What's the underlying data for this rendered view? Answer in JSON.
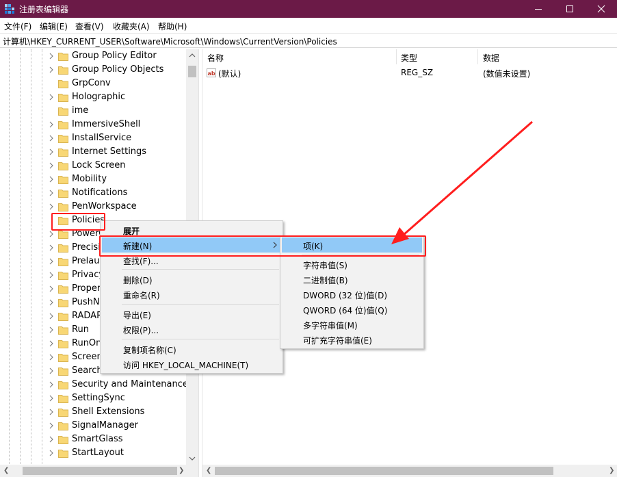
{
  "window": {
    "title": "注册表编辑器",
    "icon": "registry-editor-icon",
    "colors": {
      "titlebar": "#6b1a47",
      "highlight": "#91c9f7",
      "annotation": "#ff1e1e"
    }
  },
  "menubar": {
    "items": [
      "文件(F)",
      "编辑(E)",
      "查看(V)",
      "收藏夹(A)",
      "帮助(H)"
    ]
  },
  "address": {
    "path": "计算机\\HKEY_CURRENT_USER\\Software\\Microsoft\\Windows\\CurrentVersion\\Policies"
  },
  "tree": {
    "items": [
      "Group Policy Editor",
      "Group Policy Objects",
      "GrpConv",
      "Holographic",
      "ime",
      "ImmersiveShell",
      "InstallService",
      "Internet Settings",
      "Lock Screen",
      "Mobility",
      "Notifications",
      "PenWorkspace",
      "Policies",
      "PowerC",
      "Precisi",
      "Prelaun",
      "Privacy",
      "Proper",
      "PushNo",
      "RADAR",
      "Run",
      "RunOn",
      "Screen",
      "Search",
      "Security and Maintenance",
      "SettingSync",
      "Shell Extensions",
      "SignalManager",
      "SmartGlass",
      "StartLayout"
    ],
    "selected": "Policies"
  },
  "list": {
    "columns": [
      "名称",
      "类型",
      "数据"
    ],
    "rows": [
      {
        "name": "(默认)",
        "type": "REG_SZ",
        "data": "(数值未设置)",
        "icon": "string-value-icon"
      }
    ]
  },
  "context_menu": {
    "items": [
      "展开",
      "新建(N)",
      "查找(F)...",
      "删除(D)",
      "重命名(R)",
      "导出(E)",
      "权限(P)...",
      "复制项名称(C)",
      "访问 HKEY_LOCAL_MACHINE(T)"
    ],
    "highlighted": "新建(N)"
  },
  "submenu": {
    "items": [
      "项(K)",
      "字符串值(S)",
      "二进制值(B)",
      "DWORD (32 位)值(D)",
      "QWORD (64 位)值(Q)",
      "多字符串值(M)",
      "可扩充字符串值(E)"
    ],
    "highlighted": "项(K)"
  }
}
